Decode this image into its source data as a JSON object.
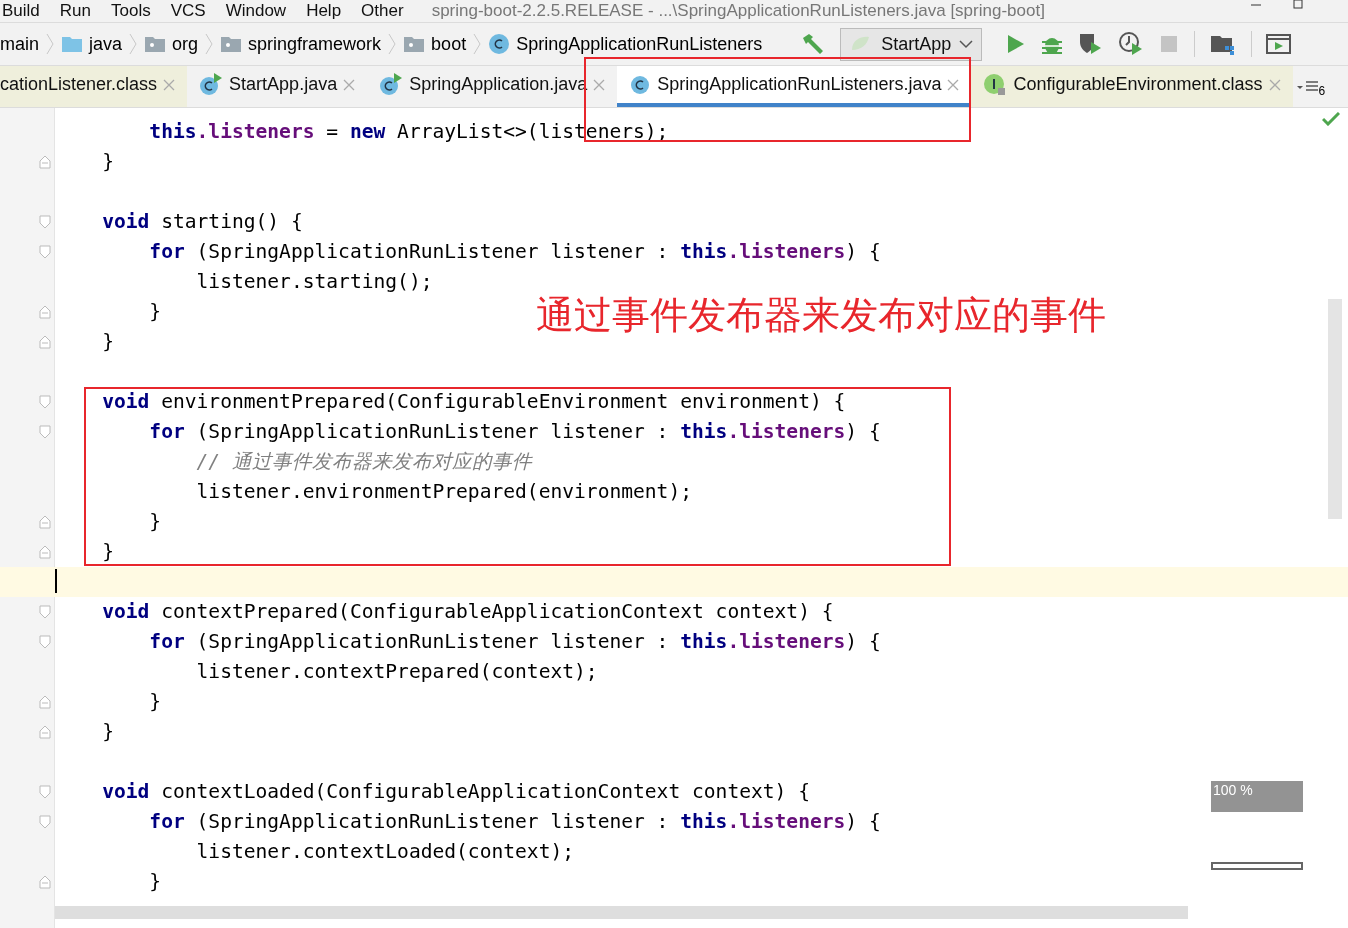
{
  "menu": [
    "Build",
    "Run",
    "Tools",
    "VCS",
    "Window",
    "Help",
    "Other"
  ],
  "window": {
    "title": "spring-boot-2.2.5.RELEASE - ...\\SpringApplicationRunListeners.java [spring-boot]"
  },
  "breadcrumbs": [
    {
      "label": "main",
      "kind": "none"
    },
    {
      "label": "java",
      "kind": "source-folder"
    },
    {
      "label": "org",
      "kind": "package"
    },
    {
      "label": "springframework",
      "kind": "package"
    },
    {
      "label": "boot",
      "kind": "package"
    },
    {
      "label": "SpringApplicationRunListeners",
      "kind": "class"
    }
  ],
  "run_config": {
    "label": "StartApp"
  },
  "tabs": [
    {
      "label": "cationListener.class",
      "kind": "compiled",
      "selected": false
    },
    {
      "label": "StartApp.java",
      "kind": "runnable",
      "selected": false
    },
    {
      "label": "SpringApplication.java",
      "kind": "runnable",
      "selected": false
    },
    {
      "label": "SpringApplicationRunListeners.java",
      "kind": "class",
      "selected": true
    },
    {
      "label": "ConfigurableEnvironment.class",
      "kind": "interface",
      "selected": false
    }
  ],
  "tab_overflow": "6",
  "code": [
    {
      "kind": "block",
      "children": [
        {
          "kind": "line",
          "current": false,
          "tokens": [
            {
              "kind": "keyword",
              "text": "this"
            },
            {
              "kind": "field",
              "text": ".listeners"
            },
            {
              "kind": "plain",
              "text": " = "
            },
            {
              "kind": "keyword",
              "text": "new"
            },
            {
              "kind": "plain",
              "text": " ArrayList<>(listeners);"
            }
          ]
        }
      ],
      "footer": [
        {
          "kind": "plain",
          "text": "}"
        }
      ]
    },
    {
      "kind": "blank",
      "current": false
    },
    {
      "kind": "block",
      "header": [
        {
          "kind": "keyword",
          "text": "void"
        },
        {
          "kind": "plain",
          "text": " starting() {"
        }
      ],
      "children": [
        {
          "kind": "block",
          "header": [
            {
              "kind": "keyword",
              "text": "for"
            },
            {
              "kind": "plain",
              "text": " (SpringApplicationRunListener listener : "
            },
            {
              "kind": "keyword",
              "text": "this"
            },
            {
              "kind": "field",
              "text": ".listeners"
            },
            {
              "kind": "plain",
              "text": ") {"
            }
          ],
          "children": [
            {
              "kind": "line",
              "current": false,
              "tokens": [
                {
                  "kind": "plain",
                  "text": "listener.starting();"
                }
              ]
            }
          ],
          "footer": [
            {
              "kind": "plain",
              "text": "}"
            }
          ]
        }
      ],
      "footer": [
        {
          "kind": "plain",
          "text": "}"
        }
      ]
    },
    {
      "kind": "blank",
      "current": false
    },
    {
      "kind": "block",
      "header": [
        {
          "kind": "keyword",
          "text": "void"
        },
        {
          "kind": "plain",
          "text": " environmentPrepared(ConfigurableEnvironment environment) {"
        }
      ],
      "children": [
        {
          "kind": "block",
          "header": [
            {
              "kind": "keyword",
              "text": "for"
            },
            {
              "kind": "plain",
              "text": " (SpringApplicationRunListener listener : "
            },
            {
              "kind": "keyword",
              "text": "this"
            },
            {
              "kind": "field",
              "text": ".listeners"
            },
            {
              "kind": "plain",
              "text": ") {"
            }
          ],
          "children": [
            {
              "kind": "line",
              "current": false,
              "tokens": [
                {
                  "kind": "comment",
                  "text": "// 通过事件发布器来发布对应的事件"
                }
              ]
            },
            {
              "kind": "line",
              "current": false,
              "tokens": [
                {
                  "kind": "plain",
                  "text": "listener.environmentPrepared(environment);"
                }
              ]
            }
          ],
          "footer": [
            {
              "kind": "plain",
              "text": "}"
            }
          ]
        }
      ],
      "footer": [
        {
          "kind": "plain",
          "text": "}"
        }
      ]
    },
    {
      "kind": "blank",
      "current": true
    },
    {
      "kind": "block",
      "header": [
        {
          "kind": "keyword",
          "text": "void"
        },
        {
          "kind": "plain",
          "text": " contextPrepared(ConfigurableApplicationContext context) {"
        }
      ],
      "children": [
        {
          "kind": "block",
          "header": [
            {
              "kind": "keyword",
              "text": "for"
            },
            {
              "kind": "plain",
              "text": " (SpringApplicationRunListener listener : "
            },
            {
              "kind": "keyword",
              "text": "this"
            },
            {
              "kind": "field",
              "text": ".listeners"
            },
            {
              "kind": "plain",
              "text": ") {"
            }
          ],
          "children": [
            {
              "kind": "line",
              "current": false,
              "tokens": [
                {
                  "kind": "plain",
                  "text": "listener.contextPrepared(context);"
                }
              ]
            }
          ],
          "footer": [
            {
              "kind": "plain",
              "text": "}"
            }
          ]
        }
      ],
      "footer": [
        {
          "kind": "plain",
          "text": "}"
        }
      ]
    },
    {
      "kind": "blank",
      "current": false
    },
    {
      "kind": "block",
      "header": [
        {
          "kind": "keyword",
          "text": "void"
        },
        {
          "kind": "plain",
          "text": " contextLoaded(ConfigurableApplicationContext context) {"
        }
      ],
      "children": [
        {
          "kind": "block",
          "header": [
            {
              "kind": "keyword",
              "text": "for"
            },
            {
              "kind": "plain",
              "text": " (SpringApplicationRunListener listener : "
            },
            {
              "kind": "keyword",
              "text": "this"
            },
            {
              "kind": "field",
              "text": ".listeners"
            },
            {
              "kind": "plain",
              "text": ") {"
            }
          ],
          "children": [
            {
              "kind": "line",
              "current": false,
              "tokens": [
                {
                  "kind": "plain",
                  "text": "listener.contextLoaded(context);"
                }
              ]
            }
          ],
          "footer": [
            {
              "kind": "plain",
              "text": "}"
            }
          ]
        }
      ]
    }
  ],
  "annotation": {
    "text": "通过事件发布器来发布对应的事件"
  },
  "zoom_indicator": "100 %"
}
